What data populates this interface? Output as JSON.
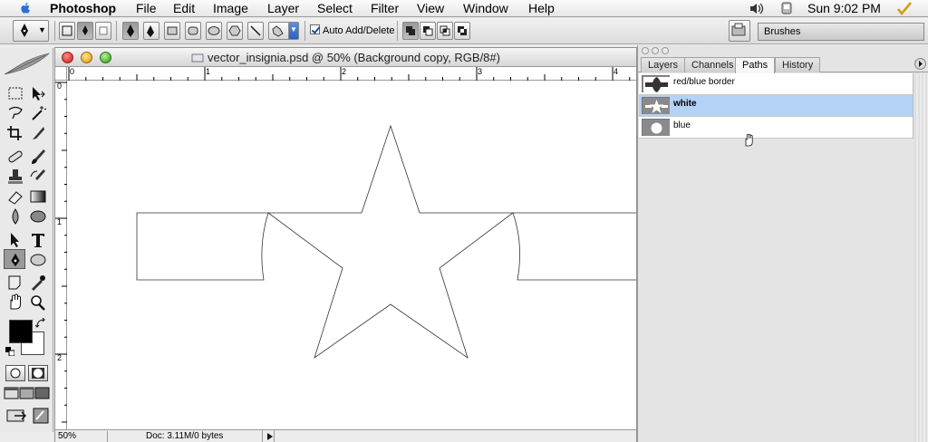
{
  "menubar": {
    "app": "Photoshop",
    "items": [
      "File",
      "Edit",
      "Image",
      "Layer",
      "Select",
      "Filter",
      "View",
      "Window",
      "Help"
    ],
    "clock": "Sun 9:02 PM"
  },
  "options": {
    "auto_add_delete": "Auto Add/Delete",
    "auto_add_checked": true,
    "brushes": "Brushes"
  },
  "document": {
    "title": "vector_insignia.psd @ 50% (Background copy, RGB/8#)",
    "ruler_h": [
      "0",
      "1",
      "2",
      "3",
      "4"
    ],
    "ruler_v": [
      "0",
      "1",
      "2"
    ],
    "zoom": "50%",
    "doc_info": "Doc: 3.11M/0 bytes"
  },
  "panel": {
    "tabs": [
      "Layers",
      "Channels",
      "Paths",
      "History"
    ],
    "active_tab": "Paths",
    "paths": [
      {
        "label": "red/blue border",
        "selected": false
      },
      {
        "label": "white",
        "selected": true
      },
      {
        "label": "blue",
        "selected": false
      }
    ]
  },
  "colors": {
    "selection": "#b4d1f6",
    "close": "#e0443e",
    "minimize": "#f2b53b",
    "zoom": "#5fbf45"
  }
}
